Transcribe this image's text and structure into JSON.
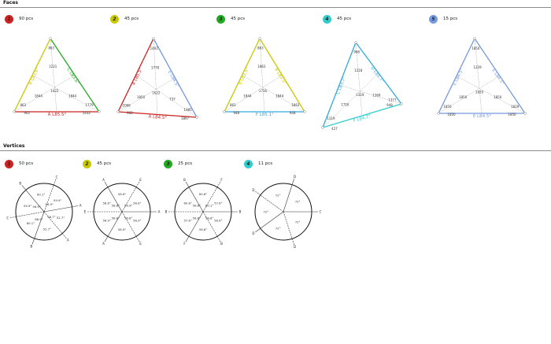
{
  "faces": {
    "title": "Faces",
    "items": [
      {
        "num": "1",
        "count": "90 pcs",
        "badge_color": "#cc2222",
        "edges": [
          {
            "text": "B L83.6°",
            "color": "#c8c800"
          },
          {
            "text": "C L83.6°",
            "color": "#22aa22"
          },
          {
            "text": "A L85.5°",
            "color": "#cc2222"
          }
        ],
        "labels": [
          "863",
          "863",
          "1779",
          "1231",
          "1844",
          "1844",
          "1422",
          "902",
          "1432"
        ]
      },
      {
        "num": "2",
        "count": "45 pcs",
        "badge_color": "#c8c800",
        "edges": [
          {
            "text": "A L85.5°",
            "color": "#cc2222"
          },
          {
            "text": "E L84.5°",
            "color": "#7799dd"
          },
          {
            "text": "A L84.5°",
            "color": "#cc2222"
          }
        ],
        "labels": [
          "1402",
          "2066",
          "1985",
          "1778",
          "1850",
          "737",
          "1622",
          "902",
          "1897"
        ]
      },
      {
        "num": "3",
        "count": "45 pcs",
        "badge_color": "#22aa22",
        "edges": [
          {
            "text": "B L83.5°",
            "color": "#c8c800"
          },
          {
            "text": "B L83.5°",
            "color": "#c8c800"
          },
          {
            "text": "F L85.1°",
            "color": "#33aadd"
          }
        ],
        "labels": [
          "863",
          "863",
          "1863",
          "1863",
          "1844",
          "1844",
          "1716",
          "948",
          "948"
        ]
      },
      {
        "num": "4",
        "count": "45 pcs",
        "badge_color": "#33cccc",
        "edges": [
          {
            "text": "C L83.7°",
            "color": "#33aadd"
          },
          {
            "text": "D L85.7°",
            "color": "#33aadd"
          },
          {
            "text": "F L84.7°",
            "color": "#33cccc"
          }
        ],
        "labels": [
          "968",
          "1319",
          "1377",
          "1218",
          "1716",
          "1369",
          "1319",
          "427",
          "948"
        ]
      },
      {
        "num": "5",
        "count": "15 pcs",
        "badge_color": "#7799dd",
        "edges": [
          {
            "text": "E L84.5°",
            "color": "#7799dd"
          },
          {
            "text": "E L84.5°",
            "color": "#7799dd"
          },
          {
            "text": "E L84.5°",
            "color": "#7799dd"
          }
        ],
        "labels": [
          "1850",
          "1850",
          "1829",
          "1229",
          "1850",
          "1850",
          "1829",
          "1850",
          "1850"
        ]
      }
    ]
  },
  "vertices": {
    "title": "Vertices",
    "items": [
      {
        "num": "1",
        "count": "50 pcs",
        "badge_color": "#cc2222",
        "spokes": [
          "A",
          "A",
          "B",
          "C",
          "B",
          "C"
        ],
        "angles": [
          "52.7°",
          "52.7°",
          "60.1°",
          "59.9°",
          "60.1°",
          "59.9°",
          "58.7°",
          "68.9°",
          "56.9°",
          "56.9°"
        ]
      },
      {
        "num": "2",
        "count": "45 pcs",
        "badge_color": "#c8c800",
        "spokes": [
          "A",
          "E",
          "A",
          "E",
          "A",
          "E"
        ],
        "angles": [
          "56.9°",
          "56.9°",
          "56.9°",
          "58.6°",
          "58.6°",
          "56.6°",
          "56.6°",
          "58.8°",
          "58.8°",
          "56.9°"
        ]
      },
      {
        "num": "3",
        "count": "25 pcs",
        "badge_color": "#22aa22",
        "spokes": [
          "B",
          "B",
          "F",
          "B",
          "B",
          "F"
        ],
        "angles": [
          "56.6°",
          "56.6°",
          "57.6°",
          "60.8°",
          "60.8°",
          "57.6°",
          "58.8°",
          "58.8°",
          "56.6°",
          "60.1°"
        ]
      },
      {
        "num": "4",
        "count": "11 pcs",
        "badge_color": "#33cccc",
        "spokes": [
          "C",
          "D",
          "D",
          "D",
          "D"
        ],
        "angles": [
          "72°",
          "72°",
          "72°",
          "72°",
          "72°"
        ]
      }
    ]
  }
}
